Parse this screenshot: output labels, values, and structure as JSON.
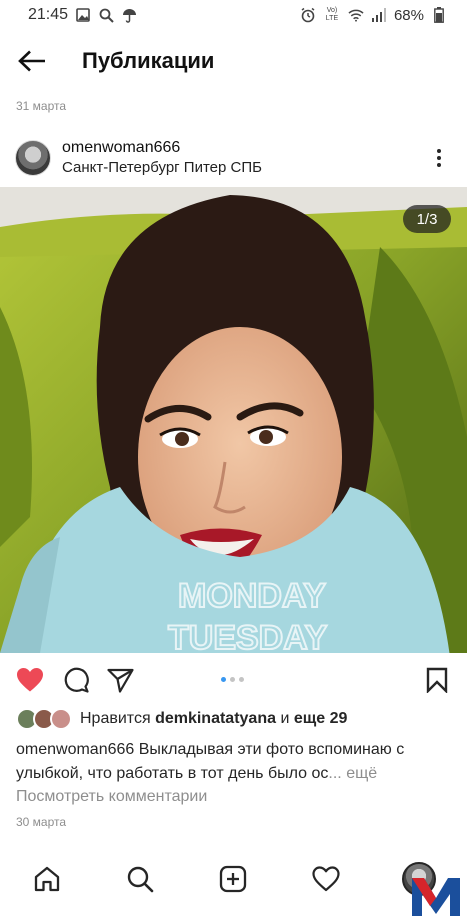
{
  "status_bar": {
    "time": "21:45",
    "network": "LTE",
    "battery": "68%"
  },
  "header": {
    "title": "Публикации"
  },
  "post": {
    "date_top": "31 марта",
    "username": "omenwoman666",
    "location": "Санкт-Петербург Питер  СПБ",
    "image_counter": "1/3",
    "shirt_text_1": "MONDAY",
    "shirt_text_2": "TUESDAY",
    "carousel": {
      "total": 3,
      "current": 1
    },
    "likes": {
      "prefix": "Нравится",
      "user": "demkinatatyana",
      "middle": "и",
      "others": "еще 29"
    },
    "caption": {
      "user": "omenwoman666",
      "text": "Выкладывая эти фото вспоминаю с улыбкой, что работать в тот день было ос",
      "ellipsis": "...",
      "more": "ещё"
    },
    "view_comments": "Посмотреть комментарии",
    "date_bottom": "30 марта",
    "liked": true
  },
  "colors": {
    "like_red": "#ed4956",
    "accent_blue": "#3897f0",
    "text_dark": "#262626",
    "text_gray": "#8e8e8e"
  },
  "icons": {
    "back": "arrow-left-icon",
    "more": "more-vertical-icon",
    "like": "heart-icon",
    "comment": "comment-icon",
    "share": "paper-plane-icon",
    "save": "bookmark-icon",
    "nav": [
      "home-icon",
      "search-icon",
      "add-post-icon",
      "activity-heart-icon",
      "profile-avatar"
    ]
  }
}
